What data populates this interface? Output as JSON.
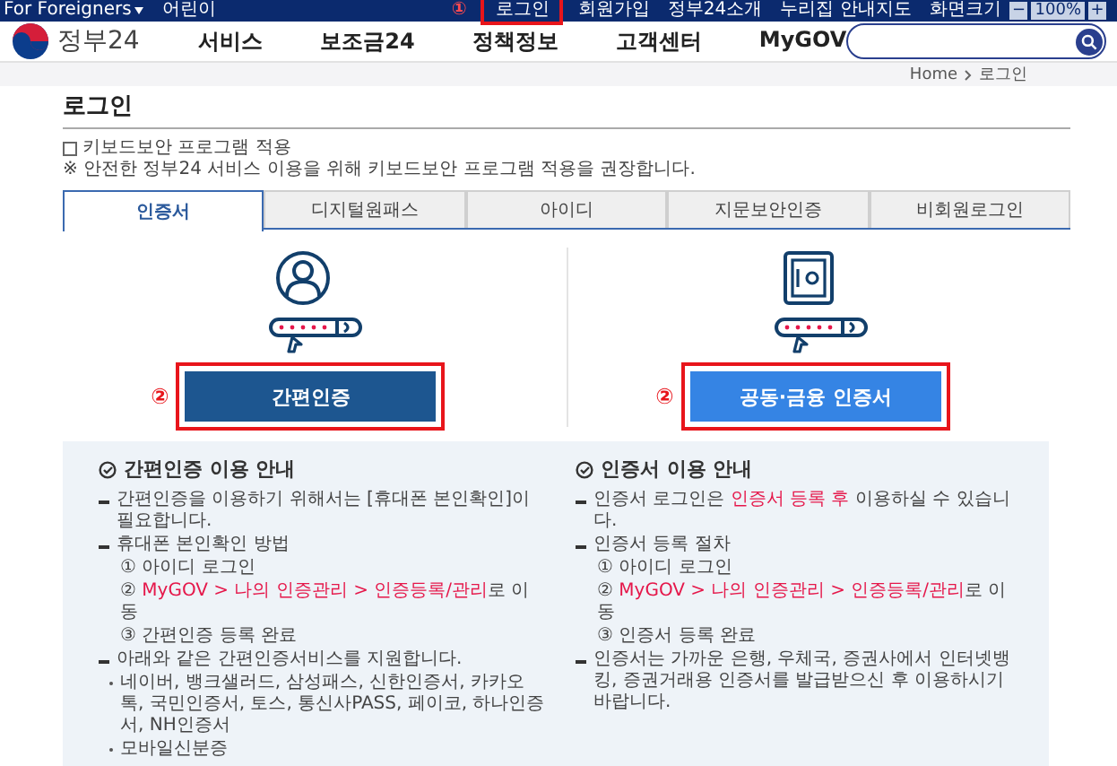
{
  "top_bar": {
    "left": [
      {
        "label": "For Foreigners",
        "dropdown": true
      },
      {
        "label": "어린이",
        "dropdown": false
      }
    ],
    "right": [
      {
        "label": "로그인",
        "annotation": "①"
      },
      {
        "label": "회원가입"
      },
      {
        "label": "정부24소개"
      },
      {
        "label": "누리집 안내지도"
      }
    ],
    "zoom": {
      "label": "화면크기",
      "minus": "−",
      "value": "100%",
      "plus": "+"
    }
  },
  "header": {
    "logo": "정부24",
    "nav": [
      "서비스",
      "보조금24",
      "정책정보",
      "고객센터",
      "MyGOV"
    ]
  },
  "breadcrumb": [
    "Home",
    "로그인"
  ],
  "page_title": "로그인",
  "keyboard_security": {
    "label": "키보드보안 프로그램 적용",
    "checked": false
  },
  "notice": "※ 안전한 정부24 서비스 이용을 위해 키보드보안 프로그램 적용을 권장합니다.",
  "tabs": [
    {
      "label": "인증서",
      "selected": true
    },
    {
      "label": "디지털원패스",
      "selected": false
    },
    {
      "label": "아이디",
      "selected": false
    },
    {
      "label": "지문보안인증",
      "selected": false
    },
    {
      "label": "비회원로그인",
      "selected": false
    }
  ],
  "login_options": [
    {
      "button": "간편인증",
      "annotation": "②"
    },
    {
      "button": "공동·금융 인증서",
      "annotation": "②"
    }
  ],
  "guides": [
    {
      "title": "간편인증 이용 안내",
      "items": [
        {
          "kind": "dash",
          "segments": [
            {
              "text": "간편인증을 이용하기 위해서는 [휴대폰 본인확인]이 필요합니다.",
              "highlight": false
            }
          ]
        },
        {
          "kind": "dash",
          "segments": [
            {
              "text": "휴대폰 본인확인 방법",
              "highlight": false
            }
          ]
        },
        {
          "kind": "step",
          "segments": [
            {
              "text": "① 아이디 로그인",
              "highlight": false
            }
          ]
        },
        {
          "kind": "step",
          "segments": [
            {
              "text": "② ",
              "highlight": false
            },
            {
              "text": "MyGOV > 나의 인증관리 > 인증등록/관리",
              "highlight": true
            },
            {
              "text": "로 이동",
              "highlight": false
            }
          ]
        },
        {
          "kind": "step",
          "segments": [
            {
              "text": "③ 간편인증 등록 완료",
              "highlight": false
            }
          ]
        },
        {
          "kind": "dash",
          "segments": [
            {
              "text": "아래와 같은 간편인증서비스를 지원합니다.",
              "highlight": false
            }
          ]
        },
        {
          "kind": "dot",
          "segments": [
            {
              "text": "네이버, 뱅크샐러드, 삼성패스, 신한인증서, 카카오톡, 국민인증서, 토스, 통신사PASS, 페이코, 하나인증서, NH인증서",
              "highlight": false
            }
          ]
        },
        {
          "kind": "dot",
          "segments": [
            {
              "text": "모바일신분증",
              "highlight": false
            }
          ]
        }
      ]
    },
    {
      "title": "인증서 이용 안내",
      "items": [
        {
          "kind": "dash",
          "segments": [
            {
              "text": "인증서 로그인은 ",
              "highlight": false
            },
            {
              "text": "인증서 등록 후",
              "highlight": true
            },
            {
              "text": " 이용하실 수 있습니다.",
              "highlight": false
            }
          ]
        },
        {
          "kind": "dash",
          "segments": [
            {
              "text": "인증서 등록 절차",
              "highlight": false
            }
          ]
        },
        {
          "kind": "step",
          "segments": [
            {
              "text": "① 아이디 로그인",
              "highlight": false
            }
          ]
        },
        {
          "kind": "step",
          "segments": [
            {
              "text": "② ",
              "highlight": false
            },
            {
              "text": "MyGOV > 나의 인증관리 > 인증등록/관리",
              "highlight": true
            },
            {
              "text": "로 이동",
              "highlight": false
            }
          ]
        },
        {
          "kind": "step",
          "segments": [
            {
              "text": "③ 인증서 등록 완료",
              "highlight": false
            }
          ]
        },
        {
          "kind": "dash",
          "segments": [
            {
              "text": "인증서는 가까운 은행, 우체국, 증권사에서 인터넷뱅킹, 증권거래용 인증서를 발급받으신 후 이용하시기 바랍니다.",
              "highlight": false
            }
          ]
        }
      ]
    }
  ]
}
